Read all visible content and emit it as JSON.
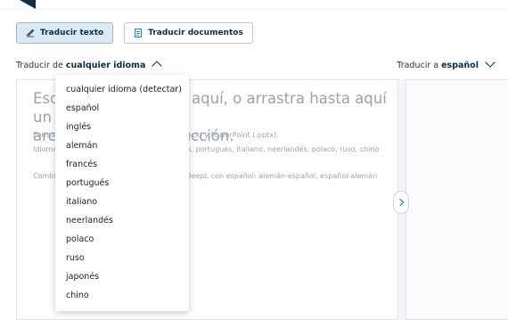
{
  "tabs": {
    "translate_text": "Traducir texto",
    "translate_documents": "Traducir documentos"
  },
  "language_bar": {
    "source_prefix": "Traducir de",
    "source_value": "cualquier idioma",
    "target_prefix": "Traducir a",
    "target_value": "español"
  },
  "input_panel": {
    "placeholder_line1": "Escribe para traducir aquí, o arrastra hasta aquí un",
    "placeholder_line2": "archivo para su traducción.",
    "hint_formats": "Formatos compatibles: PDF (.pdf), Word (.docx) y PowerPoint (.pptx).",
    "hint_languages": "Idiomas disponibles: alemán, inglés, francés, portugués, italiano, neerlandés, polaco, ruso, chino",
    "hint_glossary": "Combinaciones de idiomas del glosario de DeepL con español: alemán-español, español-alemán"
  },
  "dropdown": {
    "options": [
      "cualquier idioma (detectar)",
      "español",
      "inglés",
      "alemán",
      "francés",
      "portugués",
      "italiano",
      "neerlandés",
      "polaco",
      "ruso",
      "japonés",
      "chino"
    ]
  },
  "colors": {
    "accent": "#0f2b46",
    "tab_active_bg": "#dbe9f5",
    "link": "#0f6fb5"
  }
}
